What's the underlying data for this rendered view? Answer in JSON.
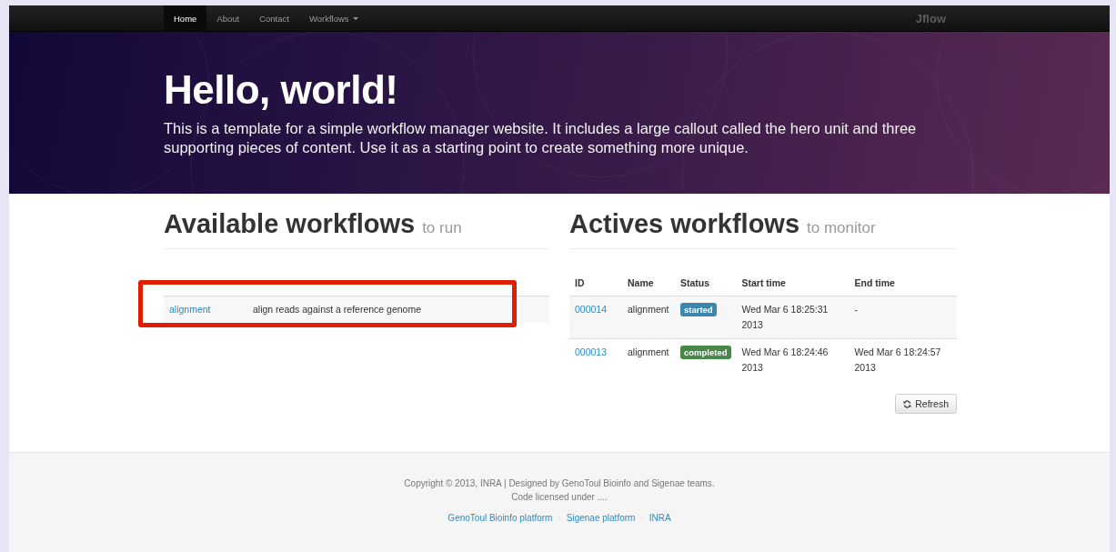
{
  "nav": {
    "items": [
      {
        "label": "Home",
        "selected": true,
        "kind": "link"
      },
      {
        "label": "About",
        "selected": false,
        "kind": "link"
      },
      {
        "label": "Contact",
        "selected": false,
        "kind": "link"
      },
      {
        "label": "Workflows",
        "selected": false,
        "kind": "dropdown"
      }
    ],
    "brand": "Jflow"
  },
  "hero": {
    "title": "Hello, world!",
    "text": "This is a template for a simple workflow manager website. It includes a large callout called the hero unit and three supporting pieces of content. Use it as a starting point to create something more unique."
  },
  "available": {
    "title": "Available workflows",
    "subtitle": "to run",
    "highlighted": true,
    "rows": [
      {
        "name": "alignment",
        "description": "align reads against a reference genome"
      }
    ]
  },
  "actives": {
    "title": "Actives workflows",
    "subtitle": "to monitor",
    "columns": [
      "ID",
      "Name",
      "Status",
      "Start time",
      "End time"
    ],
    "rows": [
      {
        "id": "000014",
        "name": "alignment",
        "status": "started",
        "color": "#3a87ad",
        "start": "Wed Mar 6 18:25:31 2013",
        "end": "-"
      },
      {
        "id": "000013",
        "name": "alignment",
        "status": "completed",
        "color": "#468847",
        "start": "Wed Mar 6 18:24:46 2013",
        "end": "Wed Mar 6 18:24:57 2013"
      }
    ],
    "refresh": "Refresh"
  },
  "footer": {
    "lines": [
      "Copyright © 2013, INRA | Designed by GenoToul Bioinfo and Sigenae teams.",
      "Code licensed under ...."
    ],
    "links": [
      "GenoToul Bioinfo platform",
      "Sigenae platform",
      "INRA"
    ],
    "separator": "·"
  }
}
